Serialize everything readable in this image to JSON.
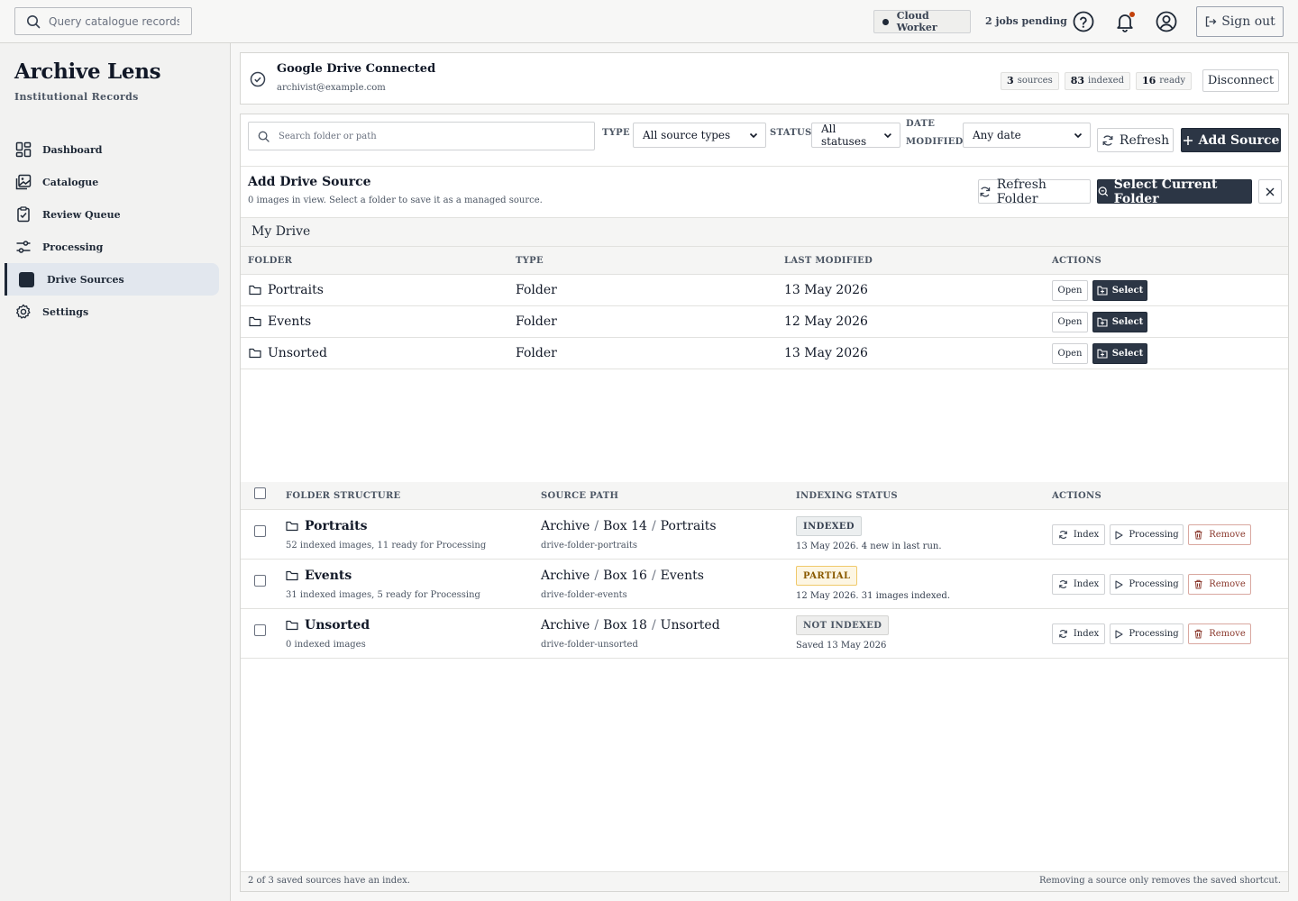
{
  "topbar": {
    "search_placeholder": "Query catalogue records, ID",
    "worker_label": "Cloud Worker",
    "pending_label": "2 jobs pending",
    "signout_label": "Sign out"
  },
  "sidebar": {
    "brand": "Archive Lens",
    "subtitle": "Institutional Records",
    "items": [
      {
        "label": "Dashboard",
        "icon": "dashboard-icon"
      },
      {
        "label": "Catalogue",
        "icon": "images-icon"
      },
      {
        "label": "Review Queue",
        "icon": "clipboard-check-icon"
      },
      {
        "label": "Processing",
        "icon": "sliders-icon"
      },
      {
        "label": "Drive Sources",
        "icon": "drive-icon",
        "active": true
      },
      {
        "label": "Settings",
        "icon": "gear-icon"
      }
    ]
  },
  "connection": {
    "title": "Google Drive Connected",
    "email": "archivist@example.com",
    "stats": [
      {
        "value": "3",
        "label": "sources"
      },
      {
        "value": "83",
        "label": "indexed"
      },
      {
        "value": "16",
        "label": "ready"
      }
    ],
    "disconnect_label": "Disconnect"
  },
  "filters": {
    "search_placeholder": "Search folder or path",
    "type_label": "TYPE",
    "type_value": "All source types",
    "status_label": "STATUS",
    "status_value": "All statuses",
    "date_label_line1": "DATE",
    "date_label_line2": "MODIFIED",
    "date_value": "Any date",
    "refresh_label": "Refresh",
    "add_source_label": "Add Source"
  },
  "add_drive": {
    "title": "Add Drive Source",
    "subtitle": "0 images in view. Select a folder to save it as a managed source.",
    "refresh_folder_label": "Refresh Folder",
    "select_current_label": "Select Current Folder",
    "breadcrumb": "My Drive",
    "headers": {
      "folder": "FOLDER",
      "type": "TYPE",
      "modified": "LAST MODIFIED",
      "actions": "ACTIONS"
    },
    "open_label": "Open",
    "select_label": "Select",
    "folders": [
      {
        "name": "Portraits",
        "type": "Folder",
        "modified": "13 May 2026"
      },
      {
        "name": "Events",
        "type": "Folder",
        "modified": "12 May 2026"
      },
      {
        "name": "Unsorted",
        "type": "Folder",
        "modified": "13 May 2026"
      }
    ]
  },
  "sources": {
    "headers": {
      "structure": "FOLDER STRUCTURE",
      "path": "SOURCE PATH",
      "status": "INDEXING STATUS",
      "actions": "ACTIONS"
    },
    "index_label": "Index",
    "processing_label": "Processing",
    "remove_label": "Remove",
    "rows": [
      {
        "name": "Portraits",
        "meta": "52 indexed images, 11 ready for Processing",
        "path": [
          "Archive",
          "Box 14",
          "Portraits"
        ],
        "id": "drive-folder-portraits",
        "status": "INDEXED",
        "note": "13 May 2026. 4 new in last run."
      },
      {
        "name": "Events",
        "meta": "31 indexed images, 5 ready for Processing",
        "path": [
          "Archive",
          "Box 16",
          "Events"
        ],
        "id": "drive-folder-events",
        "status": "PARTIAL",
        "note": "12 May 2026. 31 images indexed."
      },
      {
        "name": "Unsorted",
        "meta": "0 indexed images",
        "path": [
          "Archive",
          "Box 18",
          "Unsorted"
        ],
        "id": "drive-folder-unsorted",
        "status": "NOT INDEXED",
        "note": "Saved 13 May 2026"
      }
    ]
  },
  "footer": {
    "left": "2 of 3 saved sources have an index.",
    "right": "Removing a source only removes the saved shortcut."
  },
  "colors": {
    "primary": "#2c3645",
    "partial": "#f0c96a",
    "remove": "#8b3a2e",
    "notification_dot": "#c2410c"
  }
}
